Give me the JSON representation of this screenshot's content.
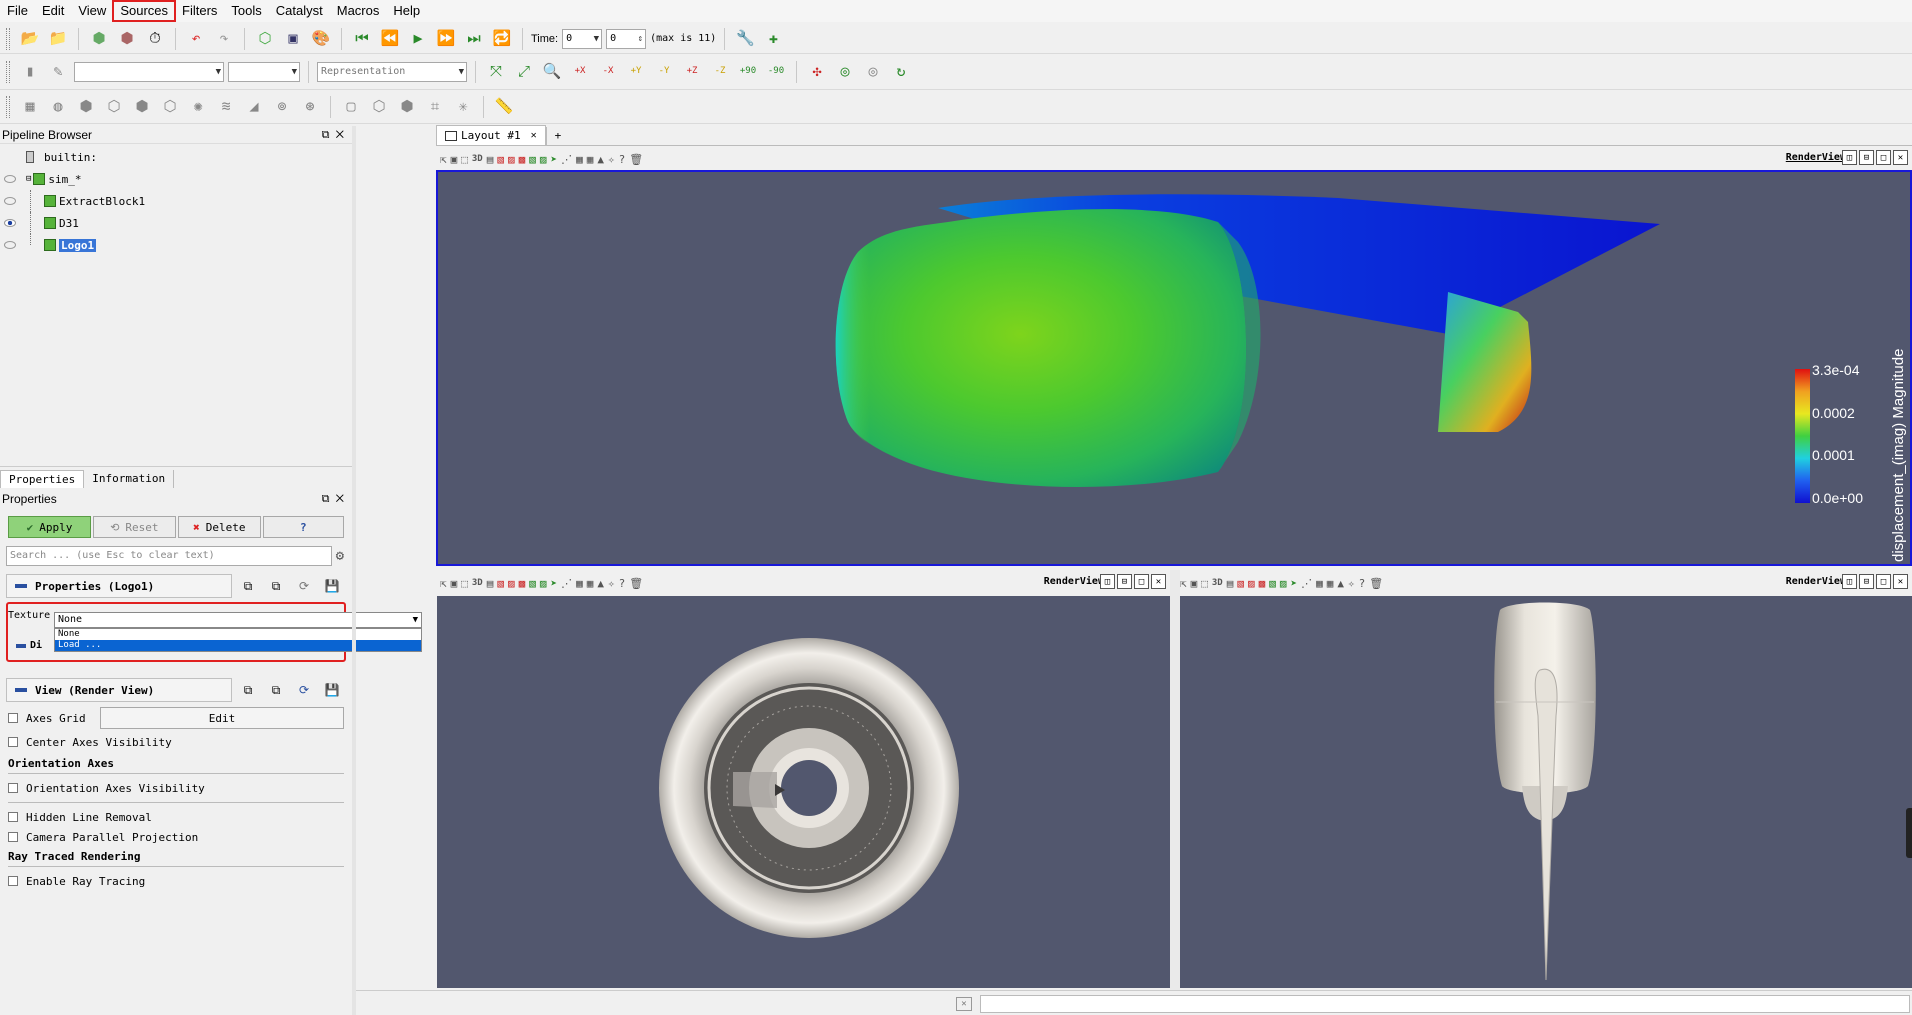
{
  "menu": [
    "File",
    "Edit",
    "View",
    "Sources",
    "Filters",
    "Tools",
    "Catalyst",
    "Macros",
    "Help"
  ],
  "menu_highlighted": "Sources",
  "toolbar_time": {
    "label": "Time:",
    "value": "0",
    "index": "0",
    "max_text": "(max is 11)"
  },
  "toolbar_representation": {
    "placeholder": "Representation"
  },
  "camera_labels": {
    "xp": "+X",
    "xm": "-X",
    "yp": "+Y",
    "ym": "-Y",
    "zp": "+Z",
    "zm": "-Z",
    "r90p": "+90",
    "r90m": "-90"
  },
  "pipeline": {
    "title": "Pipeline Browser",
    "items": [
      {
        "label": "builtin:",
        "eye": "none"
      },
      {
        "label": "sim_*",
        "eye": "off"
      },
      {
        "label": "ExtractBlock1",
        "eye": "off"
      },
      {
        "label": "D31",
        "eye": "on"
      },
      {
        "label": "Logo1",
        "eye": "off",
        "selected": true
      }
    ]
  },
  "tabs": [
    "Properties",
    "Information"
  ],
  "properties": {
    "title": "Properties",
    "apply": "Apply",
    "reset": "Reset",
    "delete": "Delete",
    "help": "?",
    "search_placeholder": "Search ... (use Esc to clear text)",
    "section_props": "Properties (Logo1)",
    "texture_label": "Texture",
    "texture_value": "None",
    "texture_options": [
      "None",
      "Load ..."
    ],
    "texture_selected": "Load ...",
    "section_display_partial": "Di",
    "section_view": "View (Render View)",
    "axes_grid": "Axes Grid",
    "edit": "Edit",
    "center_axes": "Center Axes Visibility",
    "orientation_group": "Orientation Axes",
    "orientation_vis": "Orientation Axes Visibility",
    "hidden_line": "Hidden Line Removal",
    "camera_parallel": "Camera Parallel Projection",
    "ray_group": "Ray Traced Rendering",
    "ray_enable": "Enable Ray Tracing"
  },
  "layout_tab": {
    "label": "Layout #1",
    "add": "+"
  },
  "views": {
    "v1": "RenderView1",
    "v2": "RenderView2",
    "v3": "RenderView3",
    "mode3d": "3D"
  },
  "colorbar": {
    "title": "displacement_(imag) Magnitude",
    "ticks": [
      "3.3e-04",
      "0.0002",
      "0.0001",
      "0.0e+00"
    ]
  },
  "colors": {
    "view_bg": "#52576e",
    "active_border": "#1818d8",
    "highlight": "#e02020",
    "select": "#3875d7"
  }
}
